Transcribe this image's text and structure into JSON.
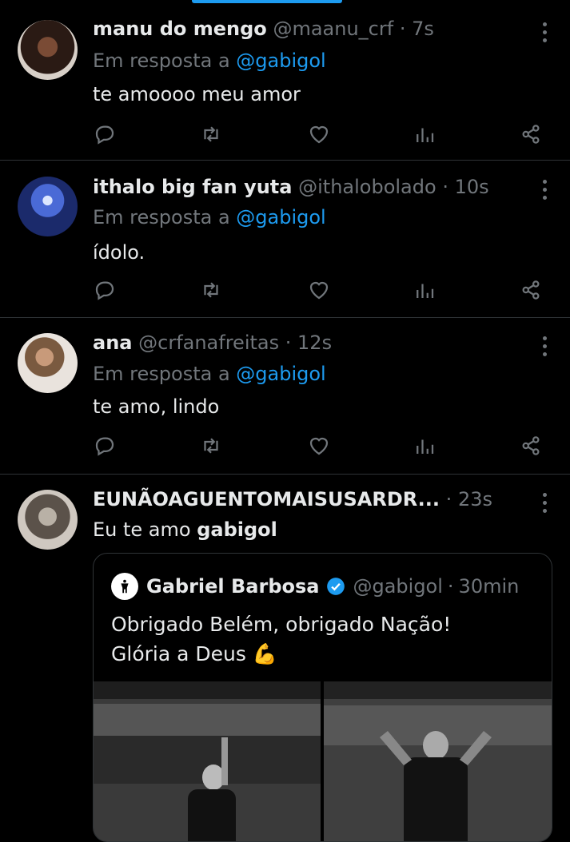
{
  "tweets": [
    {
      "name": "manu do mengo",
      "handle": "@maanu_crf",
      "time": "7s",
      "reply_prefix": "Em resposta a",
      "reply_to": "@gabigol",
      "text": "te amoooo meu amor"
    },
    {
      "name": "ithalo big fan yuta",
      "handle": "@ithalobolado",
      "time": "10s",
      "reply_prefix": "Em resposta a",
      "reply_to": "@gabigol",
      "text": "ídolo."
    },
    {
      "name": "ana",
      "handle": "@crfanafreitas",
      "time": "12s",
      "reply_prefix": "Em resposta a",
      "reply_to": "@gabigol",
      "text": "te amo, lindo"
    }
  ],
  "quote_tweet": {
    "name": "EUNÃOAGUENTOMAISUSARDR...",
    "time": "23s",
    "text_prefix": "Eu te amo",
    "text_bold": "gabigol",
    "quoted": {
      "name": "Gabriel Barbosa",
      "handle": "@gabigol",
      "time": "30min",
      "line1": "Obrigado Belém, obrigado Nação!",
      "line2": "Glória a Deus 💪"
    }
  },
  "separator": "·",
  "icons": [
    "reply-icon",
    "retweet-icon",
    "like-icon",
    "views-icon",
    "share-icon",
    "more-icon",
    "verified-icon"
  ],
  "colors": {
    "accent": "#1d9bf0",
    "muted": "#71767b",
    "background": "#000000",
    "text": "#e7e9ea"
  }
}
